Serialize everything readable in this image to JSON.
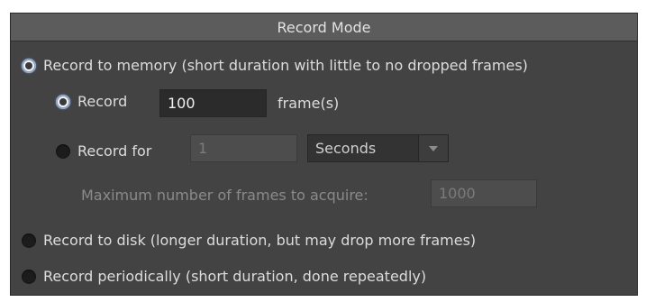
{
  "panel": {
    "title": "Record Mode",
    "options": {
      "memory": "Record to memory (short duration with little to no dropped frames)",
      "disk": "Record to disk (longer duration, but may drop more frames)",
      "periodic": "Record periodically (short duration, done repeatedly)"
    },
    "sub": {
      "record_label": "Record",
      "record_value": "100",
      "frames_unit": "frame(s)",
      "record_for_label": "Record for",
      "record_for_value": "1",
      "unit_select": "Seconds",
      "max_frames_label": "Maximum number of frames to acquire:",
      "max_frames_value": "1000"
    },
    "selected_mode": "memory",
    "selected_sub": "record_frames"
  }
}
